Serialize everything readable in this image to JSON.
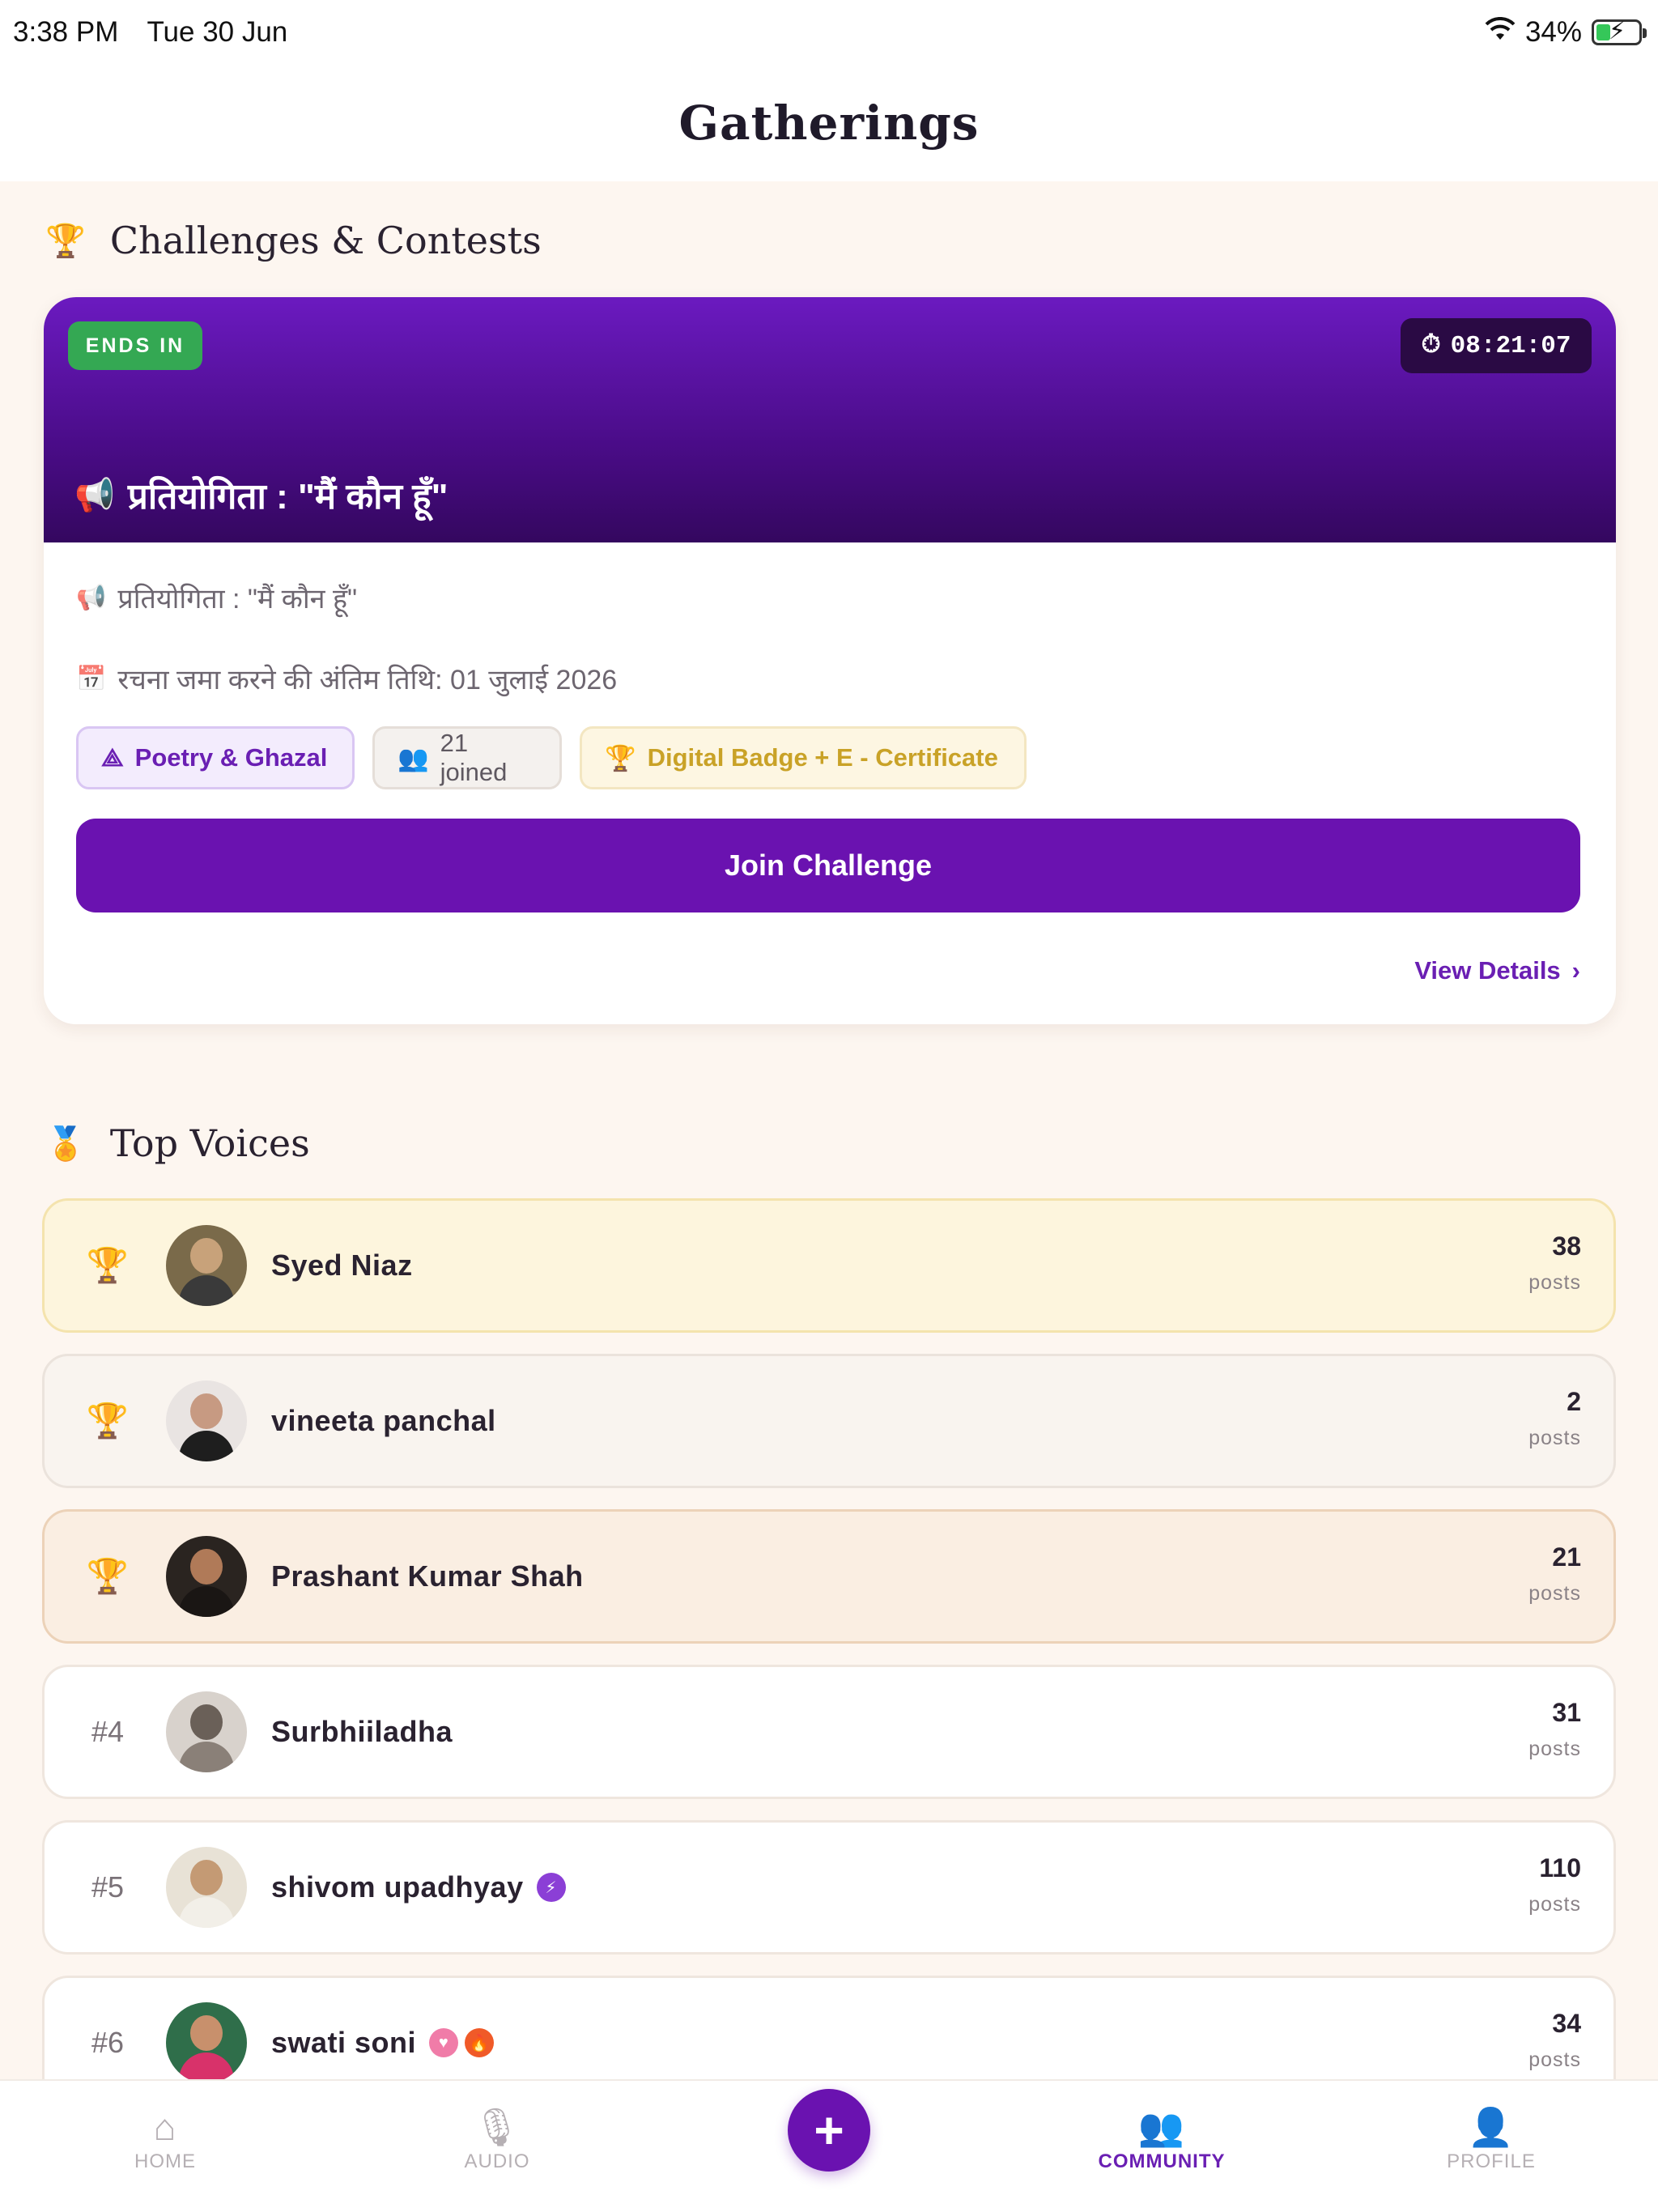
{
  "status_bar": {
    "time": "3:38 PM",
    "date": "Tue 30 Jun",
    "battery_percent": "34%",
    "battery_level": 0.34
  },
  "header": {
    "title": "Gatherings"
  },
  "challenges": {
    "section_title": "Challenges & Contests",
    "section_icon": "trophy-icon",
    "card": {
      "ends_label": "ENDS IN",
      "timer": "08:21:07",
      "timer_icon": "stopwatch-icon",
      "title": "प्रतियोगिता : \"मैं कौन हूँ\"",
      "title_icon": "megaphone-icon",
      "subtitle": "प्रतियोगिता : \"मैं कौन हूँ\"",
      "deadline": "रचना जमा करने की अंतिम तिथि: 01 जुलाई 2026",
      "deadline_icon": "calendar-icon",
      "chips": {
        "genre": "Poetry & Ghazal",
        "joined": "21 joined",
        "reward": "Digital Badge + E - Certificate"
      },
      "join_button": "Join Challenge",
      "view_details": "View Details"
    }
  },
  "top_voices": {
    "section_title": "Top Voices",
    "section_icon": "award-icon",
    "posts_label": "posts",
    "items": [
      {
        "rank": "",
        "medal": "gold",
        "name": "Syed Niaz",
        "posts": "38"
      },
      {
        "rank": "",
        "medal": "silver",
        "name": "vineeta panchal",
        "posts": "2"
      },
      {
        "rank": "",
        "medal": "bronze",
        "name": "Prashant Kumar Shah",
        "posts": "21"
      },
      {
        "rank": "#4",
        "medal": "",
        "name": "Surbhiiladha",
        "posts": "31"
      },
      {
        "rank": "#5",
        "medal": "",
        "name": "shivom upadhyay",
        "posts": "110",
        "badges": [
          "lightning-badge-icon"
        ]
      },
      {
        "rank": "#6",
        "medal": "",
        "name": "swati soni",
        "posts": "34",
        "badges": [
          "heart-badge-icon",
          "flame-badge-icon"
        ]
      }
    ]
  },
  "tab_bar": {
    "home": "HOME",
    "audio": "AUDIO",
    "community": "COMMUNITY",
    "profile": "PROFILE",
    "active": "community"
  },
  "colors": {
    "brand_purple": "#6a12b0",
    "ends_green": "#34a853",
    "gold": "#e6b800",
    "silver": "#b7b0ae",
    "bronze": "#cd7f32",
    "background": "#fdf6f0"
  }
}
